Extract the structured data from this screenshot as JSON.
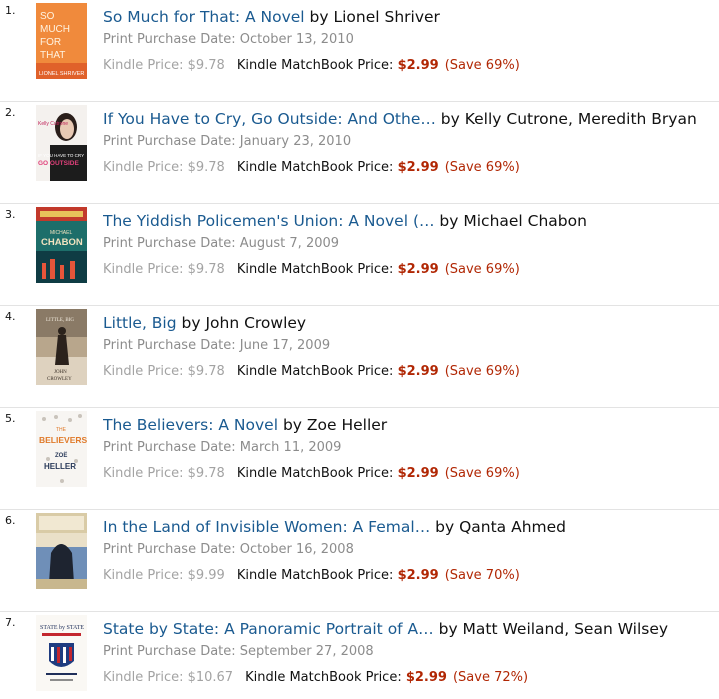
{
  "books": [
    {
      "num": "1.",
      "title": "So Much for That: A Novel",
      "by": " by Lionel Shriver",
      "date": "Print Purchase Date: October 13, 2010",
      "kindle": "Kindle Price: $9.78",
      "mb_label": "Kindle MatchBook Price: ",
      "mb_price": "$2.99",
      "save": "(Save 69%)",
      "cover_text": [
        "SO",
        "MUCH",
        "FOR",
        "THAT",
        "LIONEL SHRIVER"
      ]
    },
    {
      "num": "2.",
      "title": "If You Have to Cry, Go Outside: And Othe…",
      "by": " by Kelly Cutrone, Meredith Bryan",
      "date": "Print Purchase Date: January 23, 2010",
      "kindle": "Kindle Price: $9.78",
      "mb_label": "Kindle MatchBook Price: ",
      "mb_price": "$2.99",
      "save": "(Save 69%)",
      "cover_text": [
        "Kelly Cutrone",
        "IF YOU HAVE TO CRY",
        "GO OUTSIDE"
      ]
    },
    {
      "num": "3.",
      "title": "The Yiddish Policemen's Union: A Novel (…",
      "by": " by Michael Chabon",
      "date": "Print Purchase Date: August 7, 2009",
      "kindle": "Kindle Price: $9.78",
      "mb_label": "Kindle MatchBook Price: ",
      "mb_price": "$2.99",
      "save": "(Save 69%)",
      "cover_text": [
        "MICHAEL",
        "CHABON"
      ]
    },
    {
      "num": "4.",
      "title": "Little, Big",
      "by": " by John Crowley",
      "date": "Print Purchase Date: June 17, 2009",
      "kindle": "Kindle Price: $9.78",
      "mb_label": "Kindle MatchBook Price: ",
      "mb_price": "$2.99",
      "save": "(Save 69%)",
      "cover_text": [
        "LITTLE, BIG",
        "JOHN",
        "CROWLEY"
      ]
    },
    {
      "num": "5.",
      "title": "The Believers: A Novel",
      "by": " by Zoe Heller",
      "date": "Print Purchase Date: March 11, 2009",
      "kindle": "Kindle Price: $9.78",
      "mb_label": "Kindle MatchBook Price: ",
      "mb_price": "$2.99",
      "save": "(Save 69%)",
      "cover_text": [
        "THE",
        "BELIEVERS",
        "ZOË",
        "HELLER"
      ]
    },
    {
      "num": "6.",
      "title": "In the Land of Invisible Women: A Femal…",
      "by": " by Qanta Ahmed",
      "date": "Print Purchase Date: October 16, 2008",
      "kindle": "Kindle Price: $9.99",
      "mb_label": "Kindle MatchBook Price: ",
      "mb_price": "$2.99",
      "save": "(Save 70%)",
      "cover_text": []
    },
    {
      "num": "7.",
      "title": "State by State: A Panoramic Portrait of A…",
      "by": " by Matt Weiland, Sean Wilsey",
      "date": "Print Purchase Date: September 27, 2008",
      "kindle": "Kindle Price: $10.67",
      "mb_label": "Kindle MatchBook Price: ",
      "mb_price": "$2.99",
      "save": "(Save 72%)",
      "cover_text": [
        "STATE by STATE"
      ]
    }
  ],
  "colors": {
    "title_link": "#1a5a90",
    "price_red": "#b12704",
    "muted": "#8c8c8c"
  },
  "icons": [
    "book-cover-image"
  ]
}
